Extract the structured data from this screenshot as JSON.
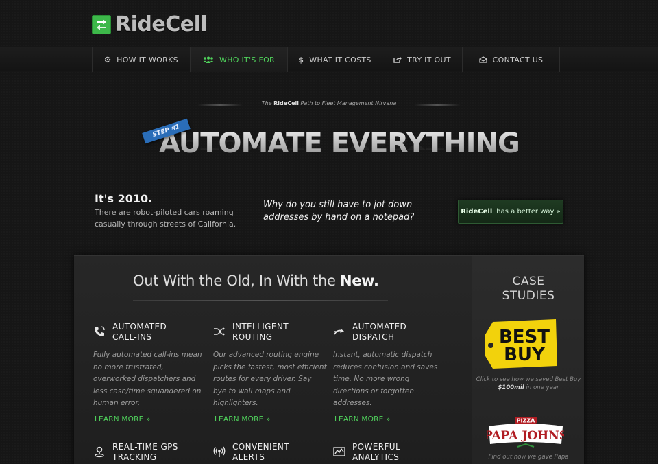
{
  "brand": {
    "name": "RideCell",
    "color": "#3db84a"
  },
  "nav": {
    "items": [
      {
        "label": "HOW IT WORKS",
        "icon": "gear-icon"
      },
      {
        "label": "WHO IT'S FOR",
        "icon": "people-icon",
        "active": true
      },
      {
        "label": "WHAT IT COSTS",
        "icon": "dollar-icon"
      },
      {
        "label": "TRY IT OUT",
        "icon": "share-icon"
      },
      {
        "label": "CONTACT US",
        "icon": "envelope-icon"
      }
    ]
  },
  "hero": {
    "tagline_pre": "The",
    "tagline_brand": "RideCell",
    "tagline_post": "Path to Fleet Management Nirvana",
    "step": "STEP #1",
    "headline": "AUTOMATE EVERYTHING"
  },
  "intro": {
    "title": "It's 2010.",
    "body": "There are robot-piloted cars roaming casually through streets of California.",
    "question": "Why do you still have to jot down addresses by hand on a notepad?",
    "cta_brand": "RideCell",
    "cta_text": "has a better way »"
  },
  "panel": {
    "title_pre": "Out With the Old, In With the ",
    "title_bold": "New.",
    "features": [
      {
        "title_line1": "AUTOMATED",
        "title_line2": "CALL-INS",
        "icon": "phone-icon",
        "desc": "Fully automated call-ins mean no more frustrated, overworked dispatchers and less cash/time squandered on human error.",
        "link": "LEARN MORE »"
      },
      {
        "title_line1": "INTELLIGENT",
        "title_line2": "ROUTING",
        "icon": "shuffle-icon",
        "desc": "Our advanced routing engine picks the fastest, most efficient routes for every driver. Say bye to wall maps and highlighters.",
        "link": "LEARN MORE »"
      },
      {
        "title_line1": "AUTOMATED",
        "title_line2": "DISPATCH",
        "icon": "arrows-icon",
        "desc": "Instant, automatic dispatch reduces confusion and saves time. No more wrong directions or forgotten addresses.",
        "link": "LEARN MORE »"
      },
      {
        "title_line1": "REAL-TIME GPS",
        "title_line2": "TRACKING",
        "icon": "location-pin-icon"
      },
      {
        "title_line1": "CONVENIENT",
        "title_line2": "ALERTS",
        "icon": "broadcast-icon"
      },
      {
        "title_line1": "POWERFUL",
        "title_line2": "ANALYTICS",
        "icon": "chart-icon"
      }
    ]
  },
  "sidebar": {
    "title_line1": "CASE",
    "title_line2": "STUDIES",
    "bestbuy": {
      "logo_line1": "BEST",
      "logo_line2": "BUY",
      "caption_pre": "Click to see how we saved Best Buy ",
      "caption_bold": "$100mil",
      "caption_post": " in one year"
    },
    "papajohns": {
      "logo_top": "PIZZA",
      "logo_main": "PAPA JOHNS",
      "caption": "Find out how we gave Papa"
    }
  }
}
